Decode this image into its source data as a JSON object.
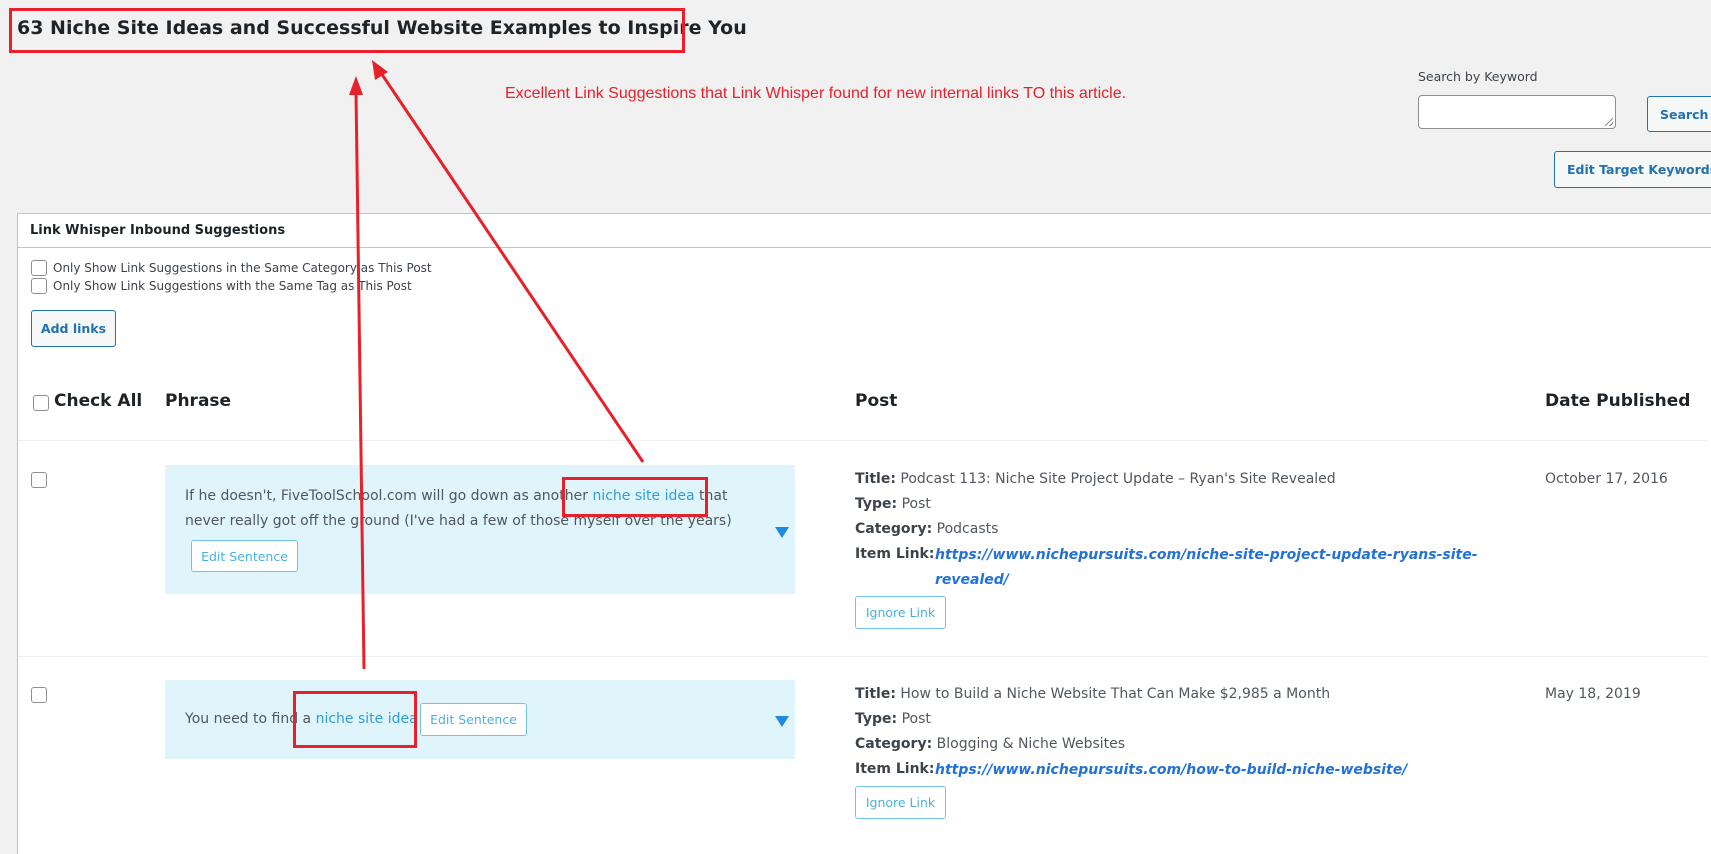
{
  "page": {
    "title": "63 Niche Site Ideas and Successful Website Examples to Inspire You",
    "annotation": "Excellent Link Suggestions that Link Whisper found for new internal links TO this article."
  },
  "search": {
    "label": "Search by Keyword",
    "value": "",
    "button_label": "Search"
  },
  "toolbar": {
    "edit_target_keywords_label": "Edit Target Keywords"
  },
  "panel": {
    "title": "Link Whisper Inbound Suggestions",
    "filters": [
      {
        "label": "Only Show Link Suggestions in the Same Category as This Post",
        "checked": false
      },
      {
        "label": "Only Show Link Suggestions with the Same Tag as This Post",
        "checked": false
      }
    ],
    "add_links_label": "Add links"
  },
  "table": {
    "headers": {
      "check_all": "Check All",
      "phrase": "Phrase",
      "post": "Post",
      "date": "Date Published"
    },
    "meta_keys": {
      "title": "Title:",
      "type": "Type:",
      "category": "Category:",
      "item_link": "Item Link:"
    },
    "edit_sentence_label": "Edit Sentence",
    "ignore_link_label": "Ignore Link",
    "rows": [
      {
        "phrase_line1_before": "If he doesn't, FiveToolSchool.com will go down as another ",
        "phrase_link": "niche site idea",
        "phrase_line1_after": " that",
        "phrase_line2": "never really got off the ground (I've had a few of those myself over the years)",
        "title": "Podcast 113: Niche Site Project Update – Ryan's Site Revealed",
        "type": "Post",
        "category": "Podcasts",
        "item_link_line1": "https://www.nichepursuits.com/niche-site-project-update-ryans-site-",
        "item_link_line2": "revealed/",
        "date": "October 17, 2016"
      },
      {
        "phrase_before": "You need to find a ",
        "phrase_link": "niche site idea",
        "title": "How to Build a Niche Website That Can Make $2,985 a Month",
        "type": "Post",
        "category": "Blogging & Niche Websites",
        "item_link": "https://www.nichepursuits.com/how-to-build-niche-website/",
        "date": "May 18, 2019"
      }
    ]
  },
  "colors": {
    "annotation_red": "#e8202a",
    "wp_blue": "#2271b1",
    "phrase_bg": "#e0f4fc",
    "link_blue": "#2e9fd8"
  }
}
